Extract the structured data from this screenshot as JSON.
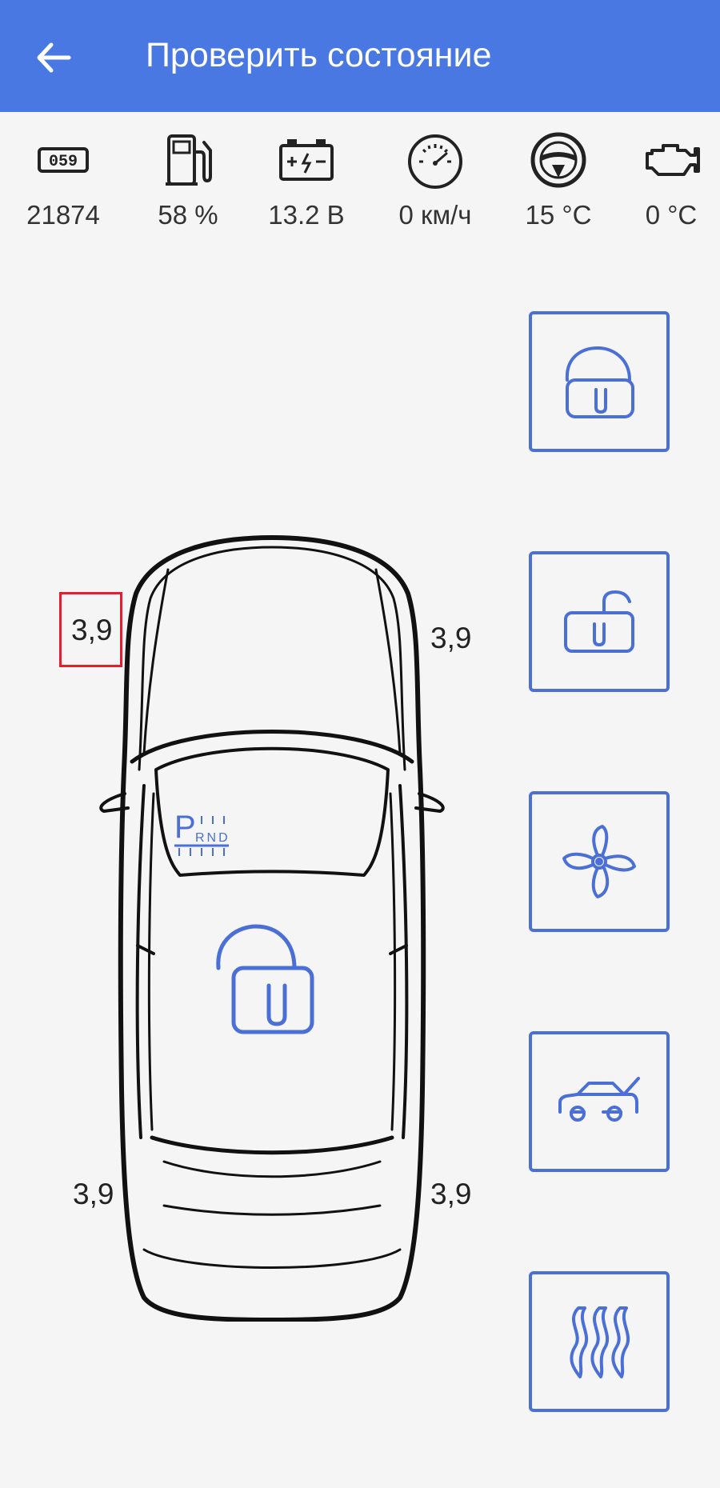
{
  "appbar": {
    "title": "Проверить состояние",
    "back_icon": "arrow-left-icon",
    "color": "#4a78e3"
  },
  "stats": {
    "odometer": {
      "icon": "odometer-icon",
      "value": "21874"
    },
    "fuel": {
      "icon": "fuel-pump-icon",
      "value": "58 %"
    },
    "battery": {
      "icon": "battery-icon",
      "value": "13.2 В"
    },
    "speed": {
      "icon": "speedometer-icon",
      "value": "0 км/ч"
    },
    "interior_temp": {
      "icon": "steering-wheel-icon",
      "value": "15 °C"
    },
    "engine_temp": {
      "icon": "engine-icon",
      "value": "0 °C"
    }
  },
  "car": {
    "tires": {
      "front_left": "3,9",
      "front_right": "3,9",
      "rear_left": "3,9",
      "rear_right": "3,9"
    },
    "gear_indicator": {
      "p": "P",
      "rnd": "RND"
    },
    "lock_icon": "padlock-open-icon"
  },
  "controls": [
    {
      "icon": "padlock-open-icon"
    },
    {
      "icon": "padlock-unlocked-flat-icon"
    },
    {
      "icon": "fan-icon"
    },
    {
      "icon": "car-trunk-open-icon"
    },
    {
      "icon": "heat-waves-icon"
    }
  ],
  "colors": {
    "accent": "#4a6fd6",
    "highlight": "#e31e2d",
    "background": "#f5f5f5"
  }
}
